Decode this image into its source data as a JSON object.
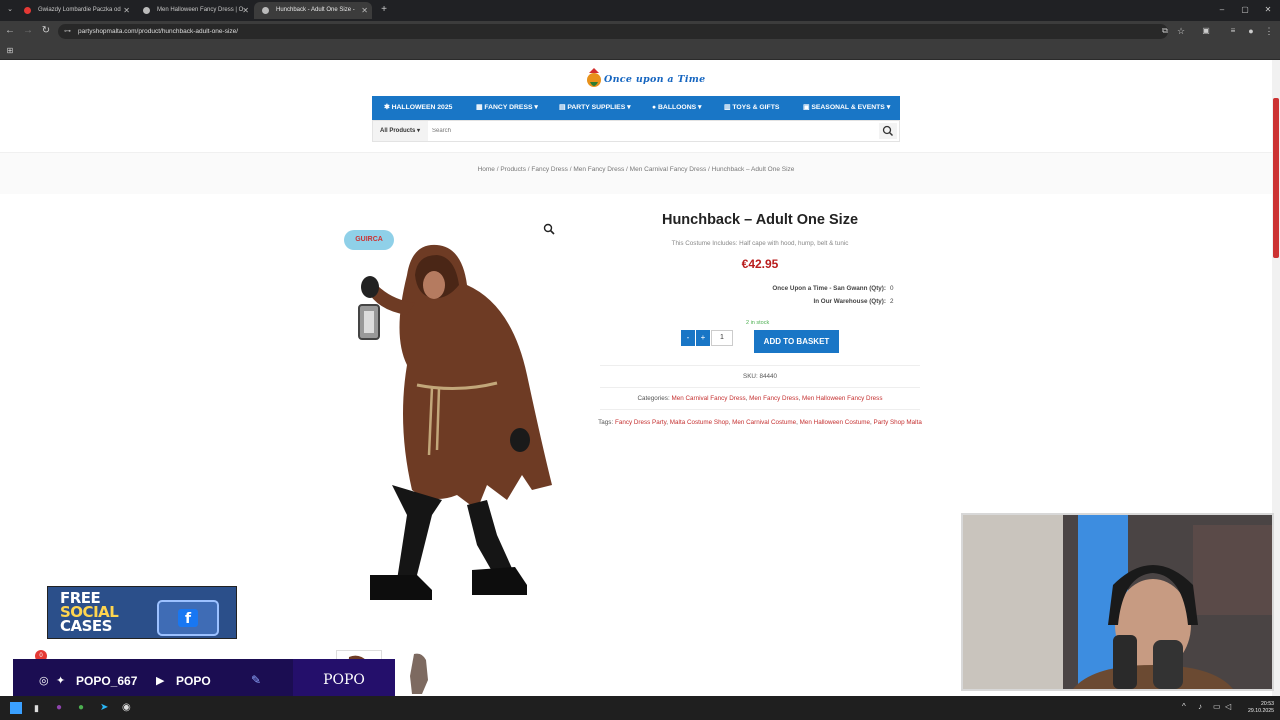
{
  "browser": {
    "tabs": [
      {
        "title": "Gwiazdy Lombardie Paczka od",
        "active": false,
        "favicon_color": "#e53935"
      },
      {
        "title": "Men Halloween Fancy Dress | O",
        "active": false,
        "favicon_color": "#bbbbbb"
      },
      {
        "title": "Hunchback - Adult One Size -",
        "active": true,
        "favicon_color": "#bbbbbb"
      }
    ],
    "url": "partyshopmalta.com/product/hunchback-adult-one-size/"
  },
  "site": {
    "logo_text": "Once upon a Time",
    "menu": [
      {
        "label": "HALLOWEEN 2025",
        "icon": "spider-icon",
        "has_dropdown": false
      },
      {
        "label": "FANCY DRESS",
        "icon": "costume-icon",
        "has_dropdown": true
      },
      {
        "label": "PARTY SUPPLIES",
        "icon": "gift-icon",
        "has_dropdown": true
      },
      {
        "label": "BALLOONS",
        "icon": "balloon-icon",
        "has_dropdown": true
      },
      {
        "label": "TOYS & GIFTS",
        "icon": "toy-icon",
        "has_dropdown": false
      },
      {
        "label": "SEASONAL & EVENTS",
        "icon": "calendar-icon",
        "has_dropdown": true
      }
    ],
    "search": {
      "category": "All Products",
      "placeholder": "Search"
    },
    "brand_color": "#1976c6"
  },
  "breadcrumb": {
    "home": "Home",
    "items": [
      "Products",
      "Fancy Dress",
      "Men Fancy Dress",
      "Men Carnival Fancy Dress"
    ],
    "current": "Hunchback – Adult One Size"
  },
  "product": {
    "brand_badge": "GUIRCA",
    "title": "Hunchback – Adult One Size",
    "description": "This Costume Includes: Half cape with hood, hump, belt & tunic",
    "price": "€42.95",
    "stock": [
      {
        "label": "Once Upon a Time - San Gwann (Qty):",
        "value": "0"
      },
      {
        "label": "In Our Warehouse (Qty):",
        "value": "2"
      }
    ],
    "in_stock_text": "2 in stock",
    "qty_minus": "-",
    "qty_plus": "+",
    "quantity": "1",
    "add_to_basket": "ADD TO BASKET",
    "sku_label": "SKU:",
    "sku": "84440",
    "categories_label": "Categories:",
    "categories": [
      "Men Carnival Fancy Dress",
      "Men Fancy Dress",
      "Men Halloween Fancy Dress"
    ],
    "tags_label": "Tags:",
    "tags": [
      "Fancy Dress Party",
      "Malta Costume Shop",
      "Men Carnival Costume",
      "Men Halloween Costume",
      "Party Shop Malta"
    ]
  },
  "overlays": {
    "ad": {
      "line1": "FREE",
      "line2": "SOCIAL",
      "line3": "CASES"
    },
    "social": {
      "handle": "POPO_667",
      "youtube": "POPO",
      "name": "POPO"
    },
    "notification_count": "0"
  },
  "taskbar": {
    "time": "20:53",
    "date": "29.10.2025"
  }
}
